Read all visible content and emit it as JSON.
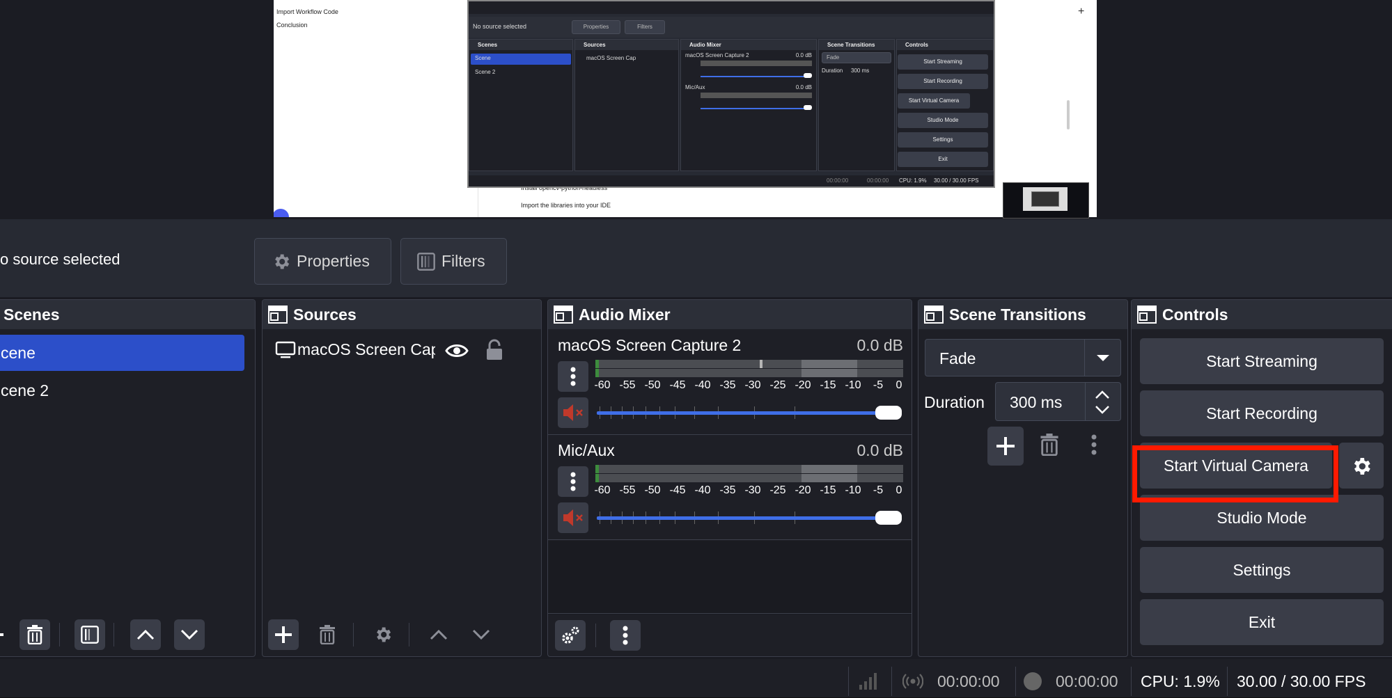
{
  "preview": {
    "doc_lines": [
      "Import Workflow Code",
      "Conclusion"
    ],
    "doc_lower": [
      "Install opencv-python-headless",
      "Import the libraries into your IDE"
    ],
    "mini": {
      "no_source": "No source selected",
      "properties": "Properties",
      "filters": "Filters",
      "scenes_title": "Scenes",
      "sources_title": "Sources",
      "mixer_title": "Audio Mixer",
      "transitions_title": "Scene Transitions",
      "controls_title": "Controls",
      "scene_items": [
        "Scene",
        "Scene 2"
      ],
      "source_item": "macOS Screen Cap",
      "mix1": "macOS Screen Capture 2",
      "mix2": "Mic/Aux",
      "mix_db": "0.0 dB",
      "fade": "Fade",
      "duration": "Duration",
      "duration_val": "300 ms",
      "controls": [
        "Start Streaming",
        "Start Recording",
        "Start Virtual Camera",
        "Studio Mode",
        "Settings",
        "Exit"
      ],
      "status": [
        "00:00:00",
        "00:00:00",
        "CPU: 1.9%",
        "30.00 / 30.00 FPS"
      ]
    }
  },
  "source_toolbar": {
    "no_source": "o source selected",
    "properties": "Properties",
    "filters": "Filters"
  },
  "scenes": {
    "title": "Scenes",
    "items": [
      {
        "label": "cene",
        "selected": true
      },
      {
        "label": "cene 2",
        "selected": false
      }
    ]
  },
  "sources": {
    "title": "Sources",
    "items": [
      {
        "label": "macOS Screen Capt"
      }
    ]
  },
  "mixer": {
    "title": "Audio Mixer",
    "channels": [
      {
        "name": "macOS Screen Capture 2",
        "db": "0.0 dB",
        "muted": true
      },
      {
        "name": "Mic/Aux",
        "db": "0.0 dB",
        "muted": true
      }
    ],
    "ticks": [
      "-60",
      "-55",
      "-50",
      "-45",
      "-40",
      "-35",
      "-30",
      "-25",
      "-20",
      "-15",
      "-10",
      "-5",
      "0"
    ]
  },
  "transitions": {
    "title": "Scene Transitions",
    "selected": "Fade",
    "duration_label": "Duration",
    "duration_value": "300 ms"
  },
  "controls": {
    "title": "Controls",
    "start_streaming": "Start Streaming",
    "start_recording": "Start Recording",
    "start_virtual_camera": "Start Virtual Camera",
    "studio_mode": "Studio Mode",
    "settings": "Settings",
    "exit": "Exit"
  },
  "status": {
    "stream_time": "00:00:00",
    "record_time": "00:00:00",
    "cpu": "CPU: 1.9%",
    "fps": "30.00 / 30.00 FPS"
  },
  "colors": {
    "accent": "#2c4fc9",
    "fader": "#3f6ee8",
    "highlight": "#ff1a00",
    "mute": "#c0392b"
  }
}
